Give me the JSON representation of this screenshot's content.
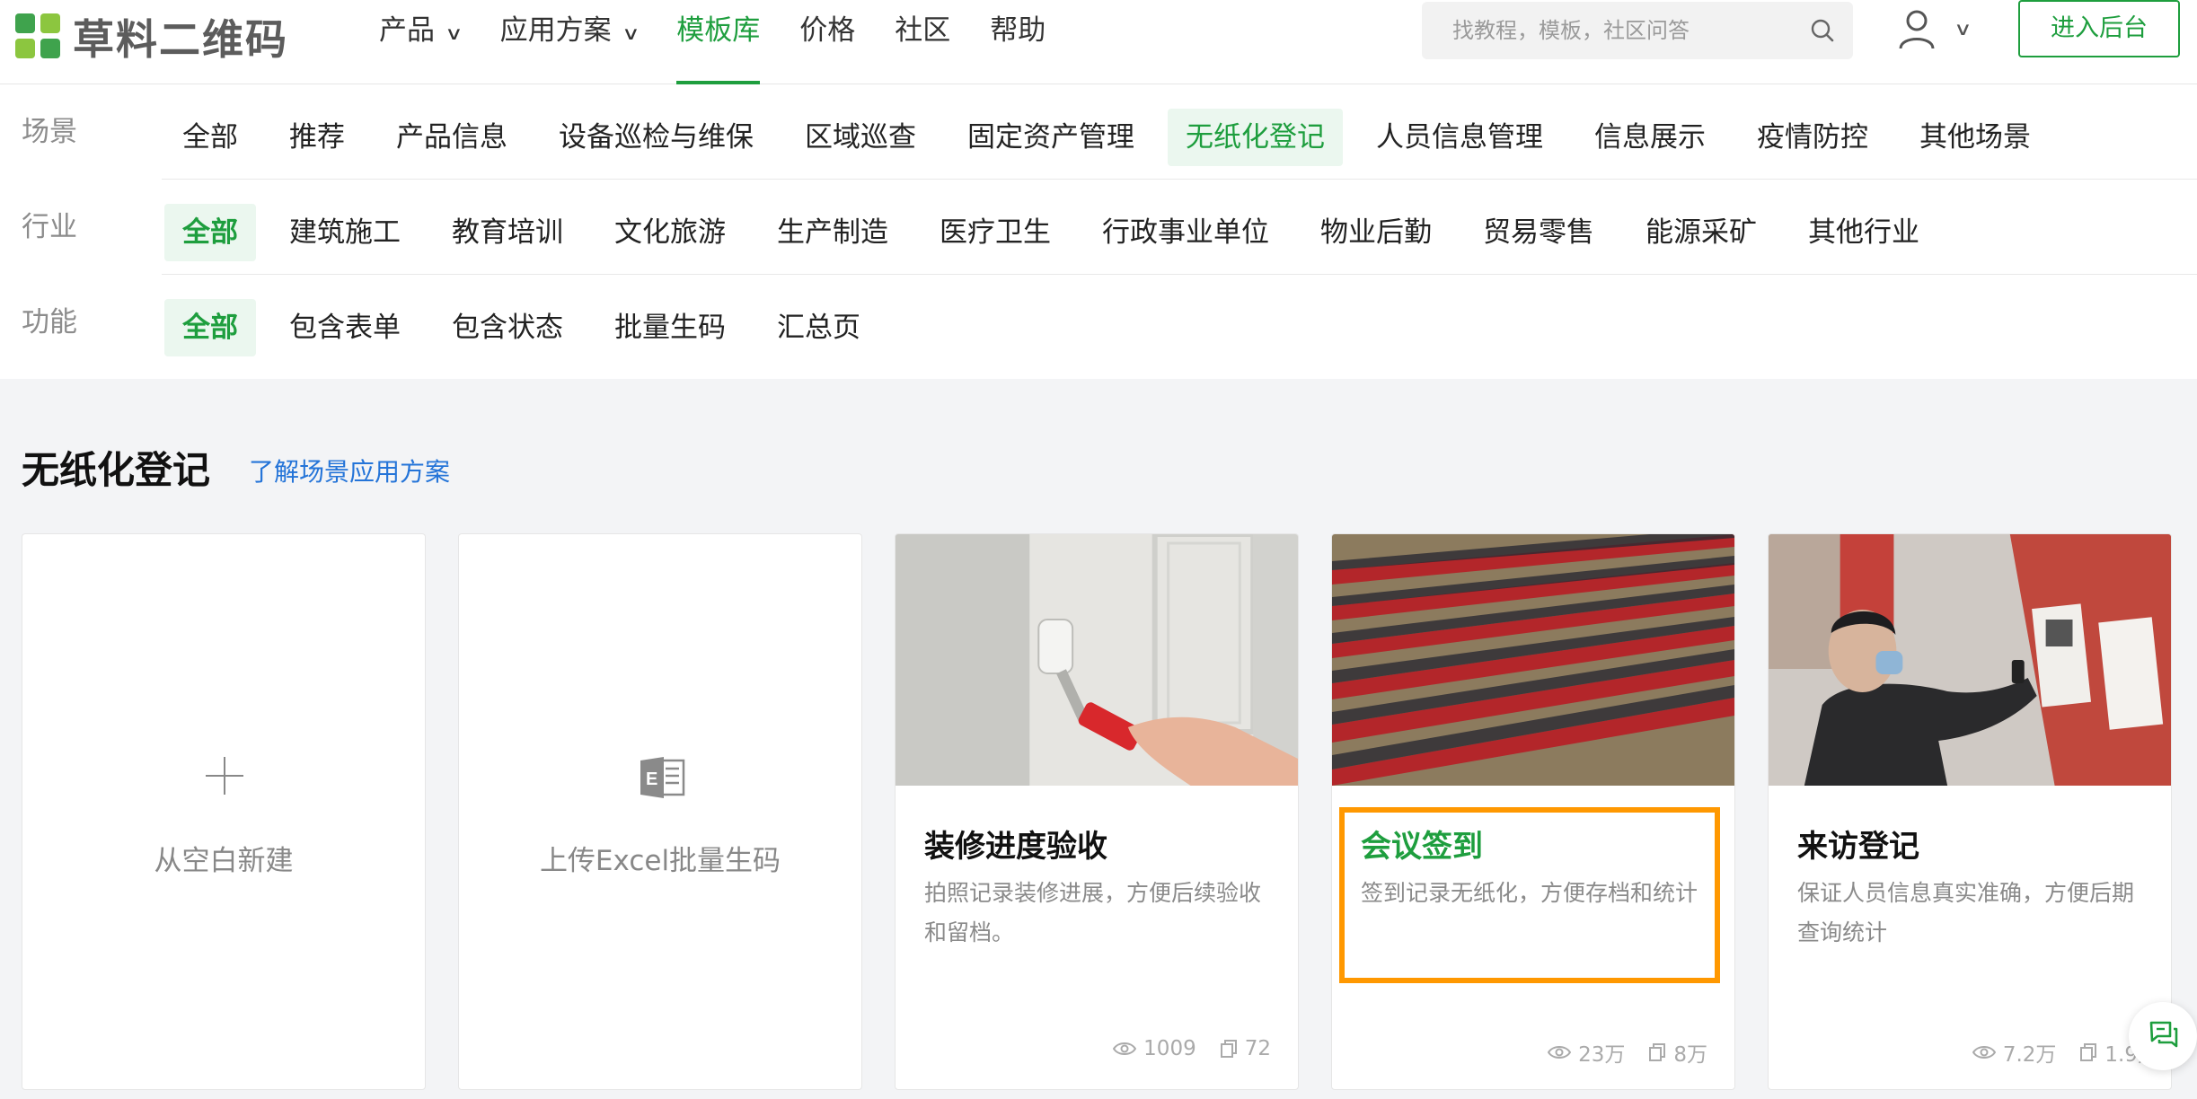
{
  "brand": {
    "name": "草料二维码"
  },
  "nav": {
    "items": [
      {
        "label": "产品",
        "has_dropdown": true
      },
      {
        "label": "应用方案",
        "has_dropdown": true
      },
      {
        "label": "模板库",
        "active": true
      },
      {
        "label": "价格"
      },
      {
        "label": "社区"
      },
      {
        "label": "帮助"
      }
    ],
    "search_placeholder": "找教程，模板，社区问答",
    "backend_button": "进入后台"
  },
  "filters": {
    "scene": {
      "label": "场景",
      "options": [
        "全部",
        "推荐",
        "产品信息",
        "设备巡检与维保",
        "区域巡查",
        "固定资产管理",
        "无纸化登记",
        "人员信息管理",
        "信息展示",
        "疫情防控",
        "其他场景"
      ],
      "selected": "无纸化登记"
    },
    "industry": {
      "label": "行业",
      "options": [
        "全部",
        "建筑施工",
        "教育培训",
        "文化旅游",
        "生产制造",
        "医疗卫生",
        "行政事业单位",
        "物业后勤",
        "贸易零售",
        "能源采矿",
        "其他行业"
      ],
      "selected": "全部"
    },
    "function": {
      "label": "功能",
      "options": [
        "全部",
        "包含表单",
        "包含状态",
        "批量生码",
        "汇总页"
      ],
      "selected": "全部"
    }
  },
  "section": {
    "title": "无纸化登记",
    "link": "了解场景应用方案"
  },
  "actions": {
    "new_blank": "从空白新建",
    "upload_excel": "上传Excel批量生码"
  },
  "templates": [
    {
      "title": "装修进度验收",
      "desc": "拍照记录装修进展，方便后续验收和留档。",
      "views": "1009",
      "copies": "72",
      "image": "wall-painting-photo"
    },
    {
      "title": "会议签到",
      "desc": "签到记录无纸化，方便存档和统计",
      "views": "23万",
      "copies": "8万",
      "image": "auditorium-photo",
      "highlighted": true
    },
    {
      "title": "来访登记",
      "desc": "保证人员信息真实准确，方便后期查询统计",
      "views": "7.2万",
      "copies": "1.9万",
      "image": "visitor-scan-photo"
    }
  ],
  "colors": {
    "brand_green": "#1e9e3e",
    "highlight_orange": "#ff9800",
    "link_blue": "#2474d8"
  }
}
